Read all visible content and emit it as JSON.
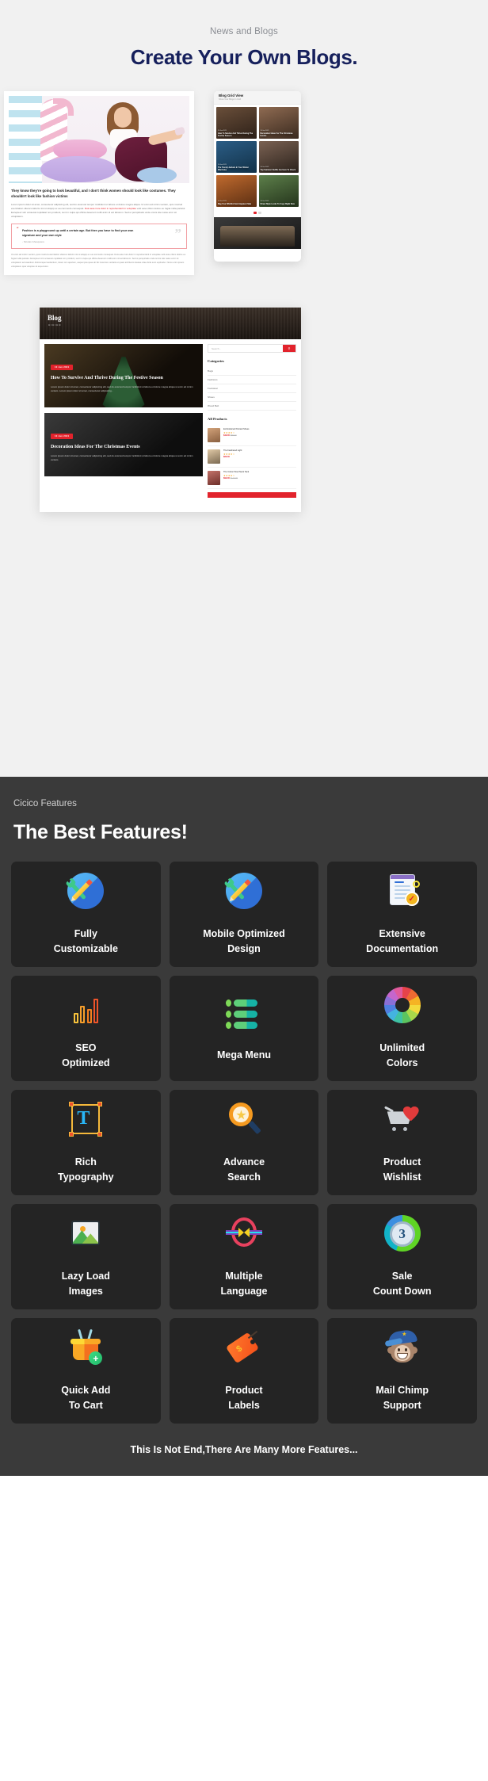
{
  "blog_section": {
    "eyebrow": "News and Blogs",
    "title": "Create Your Own Blogs.",
    "article": {
      "lead": "They know they're going to look beautiful, and I don't think women should look like costumes. They shouldn't look like fashion victims",
      "body_1": "Lorem ipsum dolor sit amet, consectetur adipiscing elit, sed do eiusmod tempor incididunt ut labore et dolore magna aliqua. Ut enim ad minim veniam, quis nostrud exercitation ullamco laboris nisi ut aliquip ex ea commodo consequat.",
      "body_highlight": "Duis aute irure dolor in reprehenderit in voluptate",
      "body_2": "velit esse cillum dolore eu fugiat nulla pariatur. Excepteur sint occaecat cupidatat non proident, sunt in culpa qui officia deserunt mollit anim id est laborum. Sed ut perspiciatis unde omnis iste natus error sit voluptatem.",
      "quote_kicker": "“",
      "quote_text": "Fashion is a playground up until a certain age. But then you have to find your own signature and your own style",
      "quote_author": "- Nicolas Ghesquiere",
      "quote_mark": "”",
      "tail": "Ut enim ad minim veniam, quis nostrud exercitation ullamco laboris nisi ut aliquip ex ea commodo consequat. Duis aute irure dolor in reprehenderit in voluptate velit esse cillum dolore eu fugiat nulla pariatur. Excepteur sint occaecat cupidatat non proident, sunt in culpa qui officia deserunt mollit anim id est laborum. Sed ut perspiciatis unde omnis iste natus error sit voluptatem accusantium doloremque laudantium, totam rem aperiam, eaque ipsa quae ab illo inventore veritatis et quasi architecto beatae vitae dicta sunt explicabo. Nemo enim ipsam voluptatem quia voluptas sit aspernatur."
    },
    "phone": {
      "title": "Blog Grid View",
      "subtitle": "Show Your Blogs In Grid",
      "cells": [
        {
          "date": "10 Jan 2021",
          "caption": "How To Survive And Thrive During The Festive Season"
        },
        {
          "date": "10 Jan 2021",
          "caption": "Decoration Ideas For The Christmas Events"
        },
        {
          "date": "10 Jan 2021",
          "caption": "The Trendy Jackets In Your Winter Wardrobe"
        },
        {
          "date": "10 Jan 2021",
          "caption": "Top Summer Outfits Are Here To Check"
        },
        {
          "date": "10 Jan 2021",
          "caption": "Bag Your Wishlist Item Happiest Sale"
        },
        {
          "date": "10 Jan 2021",
          "caption": "Street Style Looks To Copy Right Now"
        }
      ],
      "dots": [
        "1",
        "2"
      ]
    },
    "big_blog": {
      "brand": "Blog",
      "brand_sub": "CICICO",
      "posts": [
        {
          "date": "10 Jan 2021",
          "title": "How To Survive And Thrive During The Festive Season",
          "desc": "Lorem ipsum dolor sit amet, consectetur adipiscing elit, sed do eiusmod tempor incididunt ut labore et dolore magna aliqua ut enim ad minim veniam. Lorem ipsum dolor sit amet, consectetur adipisicing..."
        },
        {
          "date": "10 Jan 2021",
          "title": "Decoration Ideas For The Christmas Events",
          "desc": "Lorem ipsum dolor sit amet, consectetur adipiscing elit, sed do eiusmod tempor incididunt ut labore et dolore magna aliqua ut enim ad minim veniam."
        }
      ],
      "search_placeholder": "Search...",
      "search_icon": "search-icon",
      "categories_heading": "Categories",
      "categories": [
        "Bags",
        "Fashions",
        "Footwear",
        "Shoes",
        "Wood Belt"
      ],
      "products_heading": "All Products",
      "products": [
        {
          "name": "Embroidered Pointed Shoes",
          "stars": "★★★★☆",
          "price": "$49.00",
          "old": "$59.00"
        },
        {
          "name": "The Feathered Light",
          "stars": "★★★★☆",
          "price": "$69.00",
          "old": ""
        },
        {
          "name": "The Cotton Wool Neck Tank",
          "stars": "★★★★☆",
          "price": "$99.00",
          "old": "$129.00"
        }
      ]
    }
  },
  "features_section": {
    "eyebrow": "Cicico Features",
    "title": "The Best Features!",
    "footer": "This Is Not End,There Are Many More Features...",
    "background": "#3a3a3a",
    "card_background": "#242424",
    "items": [
      {
        "label": "Fully\nCustomizable",
        "line1": "Fully",
        "line2": "Customizable",
        "icon": "tools-icon"
      },
      {
        "label": "Mobile Optimized Design",
        "line1": "Mobile Optimized",
        "line2": "Design",
        "icon": "tools-icon"
      },
      {
        "label": "Extensive Documentation",
        "line1": "Extensive",
        "line2": "Documentation",
        "icon": "certified-document-icon"
      },
      {
        "label": "SEO Optimized",
        "line1": "SEO",
        "line2": "Optimized",
        "icon": "bar-chart-icon"
      },
      {
        "label": "Mega Menu",
        "line1": "Mega Menu",
        "line2": "",
        "icon": "menu-list-icon"
      },
      {
        "label": "Unlimited Colors",
        "line1": "Unlimited",
        "line2": "Colors",
        "icon": "color-wheel-icon"
      },
      {
        "label": "Rich Typography",
        "line1": "Rich",
        "line2": "Typography",
        "icon": "typography-icon"
      },
      {
        "label": "Advance Search",
        "line1": "Advance",
        "line2": "Search",
        "icon": "magnifier-star-icon"
      },
      {
        "label": "Product Wishlist",
        "line1": "Product",
        "line2": "Wishlist",
        "icon": "cart-heart-icon"
      },
      {
        "label": "Lazy Load Images",
        "line1": "Lazy Load",
        "line2": "Images",
        "icon": "image-icon"
      },
      {
        "label": "Multiple Language",
        "line1": "Multiple",
        "line2": "Language",
        "icon": "language-exchange-icon"
      },
      {
        "label": "Sale Count Down",
        "line1": "Sale",
        "line2": "Count Down",
        "icon": "countdown-timer-icon",
        "number": "3"
      },
      {
        "label": "Quick Add To Cart",
        "line1": "Quick Add",
        "line2": "To Cart",
        "icon": "basket-plus-icon",
        "plus": "+"
      },
      {
        "label": "Product Labels",
        "line1": "Product",
        "line2": "Labels",
        "icon": "price-tag-icon",
        "symbol": "$"
      },
      {
        "label": "Mail Chimp Support",
        "line1": "Mail Chimp",
        "line2": "Support",
        "icon": "mailchimp-monkey-icon"
      }
    ]
  }
}
